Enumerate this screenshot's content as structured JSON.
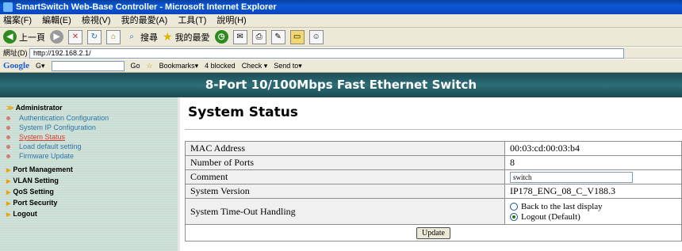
{
  "window": {
    "title": "SmartSwitch Web-Base Controller - Microsoft Internet Explorer"
  },
  "menu": {
    "items": [
      "檔案(F)",
      "編輯(E)",
      "檢視(V)",
      "我的最愛(A)",
      "工具(T)",
      "說明(H)"
    ]
  },
  "toolbar": {
    "back_label": "上一頁",
    "search_label": "搜尋",
    "favorites_label": "我的最愛"
  },
  "address": {
    "label": "網址(D)",
    "url": "http://192.168.2.1/"
  },
  "google": {
    "logo": "Google",
    "c_label": "G▾",
    "go_label": "Go",
    "bookmarks_label": "Bookmarks▾",
    "blocked_label": "4 blocked",
    "check_label": "Check ▾",
    "sendto_label": "Send to▾"
  },
  "banner": {
    "title": "8-Port 10/100Mbps Fast Ethernet Switch"
  },
  "sidebar": {
    "admin_label": "Administrator",
    "admin_items": [
      {
        "label": "Authentication Configuration"
      },
      {
        "label": "System IP Configuration"
      },
      {
        "label": "System Status"
      },
      {
        "label": "Load default setting"
      },
      {
        "label": "Firmware Update"
      }
    ],
    "sections": [
      "Port Management",
      "VLAN Setting",
      "QoS Setting",
      "Port Security",
      "Logout"
    ]
  },
  "main": {
    "title": "System Status",
    "rows": [
      {
        "label": "MAC Address",
        "value": "00:03:cd:00:03:b4"
      },
      {
        "label": "Number of Ports",
        "value": "8"
      },
      {
        "label": "Comment",
        "value": "switch"
      },
      {
        "label": "System Version",
        "value": "IP178_ENG_08_C_V188.3"
      },
      {
        "label": "System Time-Out Handling"
      }
    ],
    "timeout_options": [
      {
        "label": "Back to the last display",
        "selected": false
      },
      {
        "label": "Logout (Default)",
        "selected": true
      }
    ],
    "update_label": "Update"
  }
}
